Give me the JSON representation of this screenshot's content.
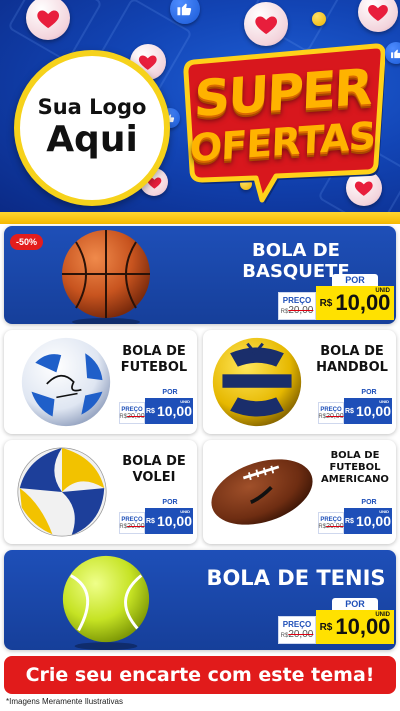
{
  "header": {
    "logo_line1": "Sua Logo",
    "logo_line2": "Aqui",
    "title_line1": "SUPER",
    "title_line2": "OFERTAS"
  },
  "featured": [
    {
      "name": "BOLA DE BASQUETE",
      "discount_badge": "-50%",
      "price": {
        "label": "PREÇO",
        "old_currency": "R$",
        "old_value": "20,00",
        "por": "POR",
        "currency": "R$",
        "value": "10,00",
        "unit": "UNID"
      }
    },
    {
      "name": "BOLA DE TENIS",
      "price": {
        "label": "PREÇO",
        "old_currency": "R$",
        "old_value": "20,00",
        "por": "POR",
        "currency": "R$",
        "value": "10,00",
        "unit": "UNID"
      }
    }
  ],
  "grid": [
    {
      "name_line1": "BOLA DE",
      "name_line2": "FUTEBOL",
      "name_line3": "",
      "price": {
        "label": "PREÇO",
        "old_currency": "R$",
        "old_value": "20,00",
        "por": "POR",
        "currency": "R$",
        "value": "10,00",
        "unit": "UNID"
      }
    },
    {
      "name_line1": "BOLA DE",
      "name_line2": "HANDBOL",
      "name_line3": "",
      "price": {
        "label": "PREÇO",
        "old_currency": "R$",
        "old_value": "20,00",
        "por": "POR",
        "currency": "R$",
        "value": "10,00",
        "unit": "UNID"
      }
    },
    {
      "name_line1": "BOLA DE",
      "name_line2": "VOLEI",
      "name_line3": "",
      "price": {
        "label": "PREÇO",
        "old_currency": "R$",
        "old_value": "20,00",
        "por": "POR",
        "currency": "R$",
        "value": "10,00",
        "unit": "UNID"
      }
    },
    {
      "name_line1": "BOLA DE",
      "name_line2": "FUTEBOL",
      "name_line3": "AMERICANO",
      "price": {
        "label": "PREÇO",
        "old_currency": "R$",
        "old_value": "20,00",
        "por": "POR",
        "currency": "R$",
        "value": "10,00",
        "unit": "UNID"
      }
    }
  ],
  "ball_brands": {
    "futebol": "umbro",
    "handbol": "PENALTY",
    "volei": "MIKASA"
  },
  "cta_text": "Crie seu encarte com este tema!",
  "footnote": "*Imagens Meramente Ilustrativas",
  "colors": {
    "primary_blue": "#1e4fb8",
    "accent_yellow": "#ffe100",
    "cta_red": "#e11b1b",
    "title_orange": "#ffb300"
  },
  "icons": [
    "heart-icon",
    "thumbs-up-icon",
    "laughing-emoji-icon",
    "basketball-image",
    "soccer-ball-image",
    "handball-image",
    "volleyball-image",
    "american-football-image",
    "tennis-ball-image"
  ]
}
